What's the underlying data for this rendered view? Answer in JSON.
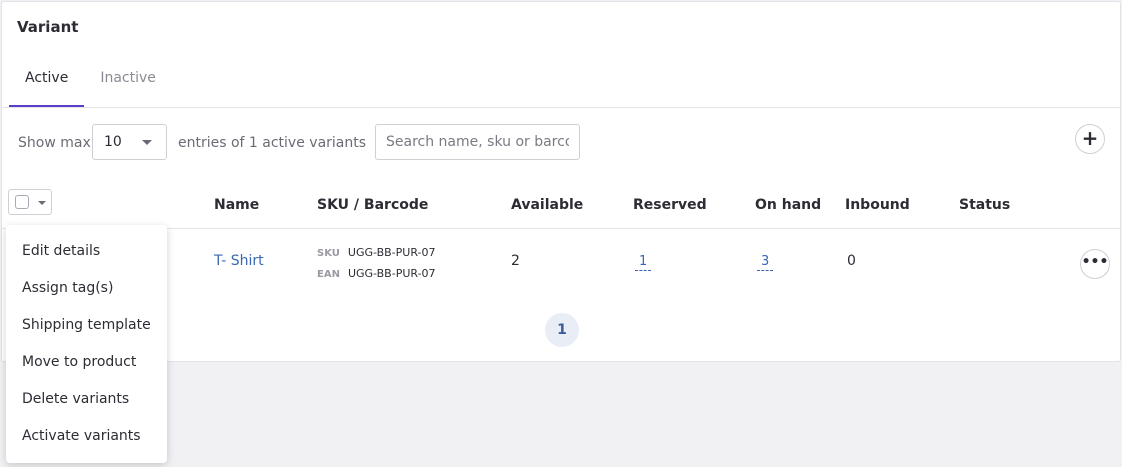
{
  "card": {
    "title": "Variant"
  },
  "tabs": [
    {
      "label": "Active"
    },
    {
      "label": "Inactive"
    }
  ],
  "toolbar": {
    "show_max_label": "Show max.",
    "page_size": "10",
    "entries_text": "entries of 1 active variants",
    "search_placeholder": "Search name, sku or barcode",
    "add_label": "+"
  },
  "table": {
    "headers": [
      "Name",
      "SKU / Barcode",
      "Available",
      "Reserved",
      "On hand",
      "Inbound",
      "Status"
    ],
    "rows": [
      {
        "name": "T- Shirt",
        "sku_label": "SKU",
        "sku": "UGG-BB-PUR-07",
        "ean_label": "EAN",
        "ean": "UGG-BB-PUR-07",
        "available": "2",
        "reserved": "1",
        "on_hand": "3",
        "inbound": "0",
        "status": ""
      }
    ]
  },
  "pagination": {
    "current": "1"
  },
  "bulk_menu": {
    "items": [
      "Edit details",
      "Assign tag(s)",
      "Shipping template",
      "Move to product",
      "Delete variants",
      "Activate variants"
    ]
  },
  "colors": {
    "accent": "#5b3fc9",
    "link": "#3a67b3"
  }
}
